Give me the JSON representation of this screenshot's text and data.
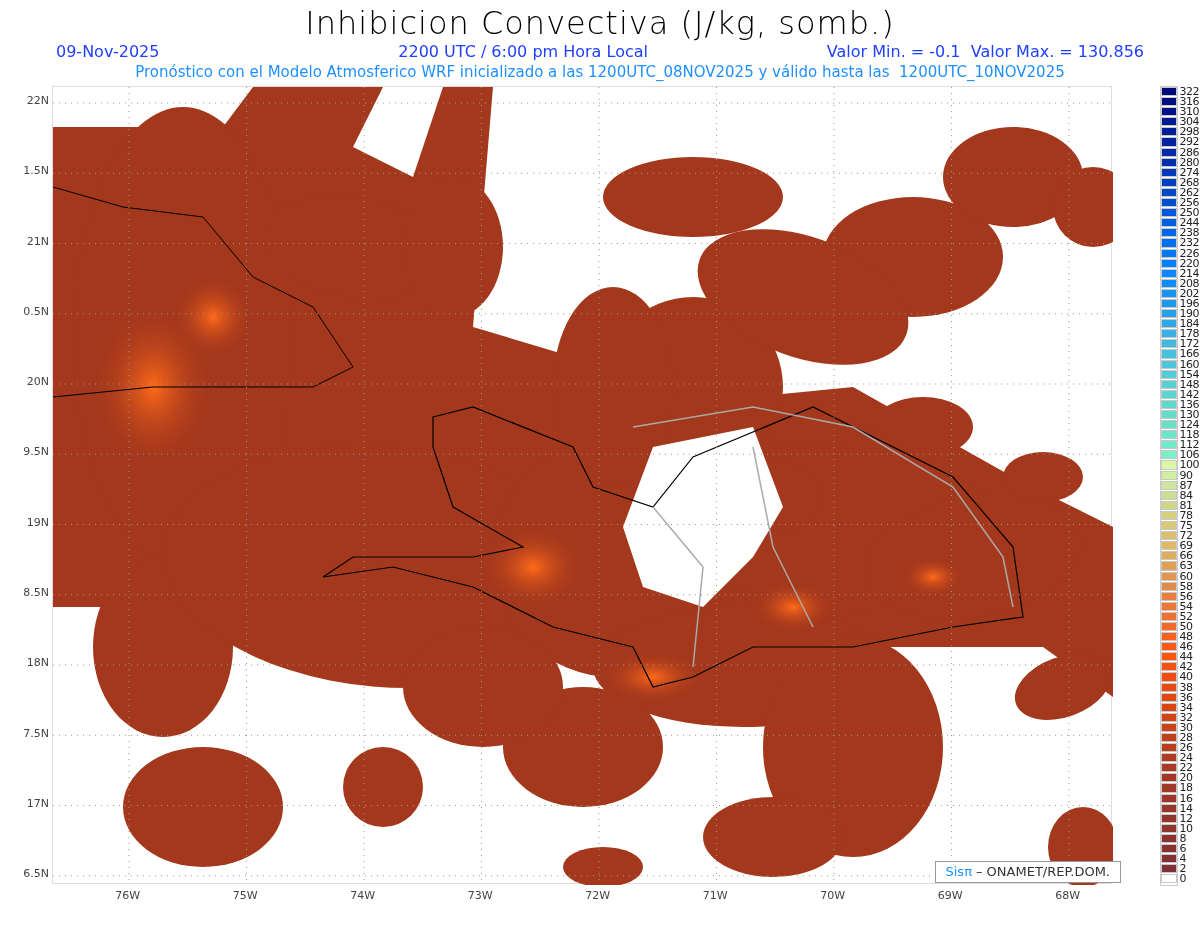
{
  "title": "Inhibicion Convectiva (J/kg, somb.)",
  "date": "09-Nov-2025",
  "time": "2200 UTC / 6:00 pm Hora Local",
  "range": "Valor Min. = -0.1  Valor Max. = 130.856",
  "subtitle": "Pronóstico con el Modelo Atmosferico WRF inicializado a las 1200UTC_08NOV2025 y válido hasta las  1200UTC_10NOV2025",
  "lat_labels": [
    "22N",
    "1.5N",
    "21N",
    "0.5N",
    "20N",
    "9.5N",
    "19N",
    "8.5N",
    "18N",
    "7.5N",
    "17N",
    "6.5N"
  ],
  "lon_labels": [
    "76W",
    "75W",
    "74W",
    "73W",
    "72W",
    "71W",
    "70W",
    "69W",
    "68W"
  ],
  "credit": {
    "brand": "Sisπ",
    "text": "– ONAMET/REP.DOM."
  },
  "legend": [
    {
      "label": "322",
      "color": "#000a78"
    },
    {
      "label": "316",
      "color": "#000e80"
    },
    {
      "label": "310",
      "color": "#001288"
    },
    {
      "label": "304",
      "color": "#001890"
    },
    {
      "label": "298",
      "color": "#001e98"
    },
    {
      "label": "292",
      "color": "#0024a0"
    },
    {
      "label": "286",
      "color": "#002aa8"
    },
    {
      "label": "280",
      "color": "#0030b0"
    },
    {
      "label": "274",
      "color": "#0038b8"
    },
    {
      "label": "268",
      "color": "#0040c0"
    },
    {
      "label": "262",
      "color": "#0048c8"
    },
    {
      "label": "256",
      "color": "#0050d0"
    },
    {
      "label": "250",
      "color": "#0058d8"
    },
    {
      "label": "244",
      "color": "#0060e0"
    },
    {
      "label": "238",
      "color": "#0068e8"
    },
    {
      "label": "232",
      "color": "#0070f0"
    },
    {
      "label": "226",
      "color": "#0078f8"
    },
    {
      "label": "220",
      "color": "#0080ff"
    },
    {
      "label": "214",
      "color": "#0a88ff"
    },
    {
      "label": "208",
      "color": "#108cf8"
    },
    {
      "label": "202",
      "color": "#1892f0"
    },
    {
      "label": "196",
      "color": "#2098ea"
    },
    {
      "label": "190",
      "color": "#28a0e8"
    },
    {
      "label": "184",
      "color": "#30a8e6"
    },
    {
      "label": "178",
      "color": "#38b0e4"
    },
    {
      "label": "172",
      "color": "#40b8e0"
    },
    {
      "label": "166",
      "color": "#48c0de"
    },
    {
      "label": "160",
      "color": "#50c6da"
    },
    {
      "label": "154",
      "color": "#54ccd8"
    },
    {
      "label": "148",
      "color": "#58d0d4"
    },
    {
      "label": "142",
      "color": "#5cd4d0"
    },
    {
      "label": "136",
      "color": "#60d8cc"
    },
    {
      "label": "130",
      "color": "#64dcca"
    },
    {
      "label": "124",
      "color": "#68e0c8"
    },
    {
      "label": "118",
      "color": "#6ce6c8"
    },
    {
      "label": "112",
      "color": "#70eac8"
    },
    {
      "label": "106",
      "color": "#78f0c8"
    },
    {
      "label": "100",
      "color": "#d8f8a8"
    },
    {
      "label": "90",
      "color": "#d0f0a0"
    },
    {
      "label": "87",
      "color": "#cce898"
    },
    {
      "label": "84",
      "color": "#cce090"
    },
    {
      "label": "81",
      "color": "#d0d888"
    },
    {
      "label": "78",
      "color": "#d4d080"
    },
    {
      "label": "75",
      "color": "#d8c878"
    },
    {
      "label": "72",
      "color": "#dcc070"
    },
    {
      "label": "69",
      "color": "#e0b868"
    },
    {
      "label": "66",
      "color": "#e0ac60"
    },
    {
      "label": "63",
      "color": "#e0a058"
    },
    {
      "label": "60",
      "color": "#e29450"
    },
    {
      "label": "58",
      "color": "#e48a48"
    },
    {
      "label": "56",
      "color": "#e88040"
    },
    {
      "label": "54",
      "color": "#ec7838"
    },
    {
      "label": "52",
      "color": "#f07030"
    },
    {
      "label": "50",
      "color": "#f46828"
    },
    {
      "label": "48",
      "color": "#f86020"
    },
    {
      "label": "46",
      "color": "#fc5818"
    },
    {
      "label": "44",
      "color": "#ff5410"
    },
    {
      "label": "42",
      "color": "#f85010"
    },
    {
      "label": "40",
      "color": "#f04c10"
    },
    {
      "label": "38",
      "color": "#e84a12"
    },
    {
      "label": "36",
      "color": "#e04814"
    },
    {
      "label": "34",
      "color": "#d84616"
    },
    {
      "label": "32",
      "color": "#d04418"
    },
    {
      "label": "30",
      "color": "#c8421a"
    },
    {
      "label": "28",
      "color": "#c0401c"
    },
    {
      "label": "26",
      "color": "#b83e1e"
    },
    {
      "label": "24",
      "color": "#b03c20"
    },
    {
      "label": "22",
      "color": "#aa3a22"
    },
    {
      "label": "20",
      "color": "#a43824"
    },
    {
      "label": "18",
      "color": "#a03826"
    },
    {
      "label": "16",
      "color": "#9c3628"
    },
    {
      "label": "14",
      "color": "#98362a"
    },
    {
      "label": "12",
      "color": "#94342c"
    },
    {
      "label": "10",
      "color": "#90342e"
    },
    {
      "label": "8",
      "color": "#8c3230"
    },
    {
      "label": "6",
      "color": "#883232"
    },
    {
      "label": "4",
      "color": "#843034"
    },
    {
      "label": "2",
      "color": "#803036"
    },
    {
      "label": "0",
      "color": "#ffffff"
    }
  ]
}
